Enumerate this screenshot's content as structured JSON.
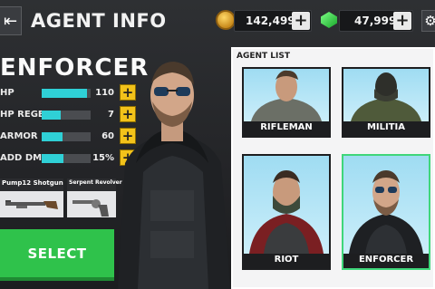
{
  "header": {
    "back_icon": "back-arrow-icon",
    "title": "AGENT INFO",
    "coins": "142,499",
    "gems": "47,999",
    "settings_icon": "gear-icon"
  },
  "agent": {
    "name": "ENFORCER",
    "stats": [
      {
        "label": "HP",
        "value": "110",
        "fill": 0.92
      },
      {
        "label": "HP REGEN",
        "value": "7",
        "fill": 0.38
      },
      {
        "label": "ARMOR",
        "value": "60",
        "fill": 0.42
      },
      {
        "label": "ADD DMG",
        "value": "15%",
        "fill": 0.45
      }
    ],
    "weapons": [
      {
        "name": "Pump12 Shotgun",
        "icon": "shotgun-icon"
      },
      {
        "name": "Serpent Revolver",
        "icon": "revolver-icon"
      }
    ],
    "select_label": "SELECT"
  },
  "agent_list": {
    "header": "AGENT LIST",
    "items": [
      {
        "label": "RIFLEMAN",
        "selected": false
      },
      {
        "label": "MILITIA",
        "selected": false
      },
      {
        "label": "RIOT",
        "selected": false
      },
      {
        "label": "ENFORCER",
        "selected": true
      }
    ]
  },
  "colors": {
    "accent_bar": "#2fd0d6",
    "select_green": "#2fc24b",
    "plus_yellow": "#f2c21a",
    "selected_border": "#3fd67a"
  }
}
